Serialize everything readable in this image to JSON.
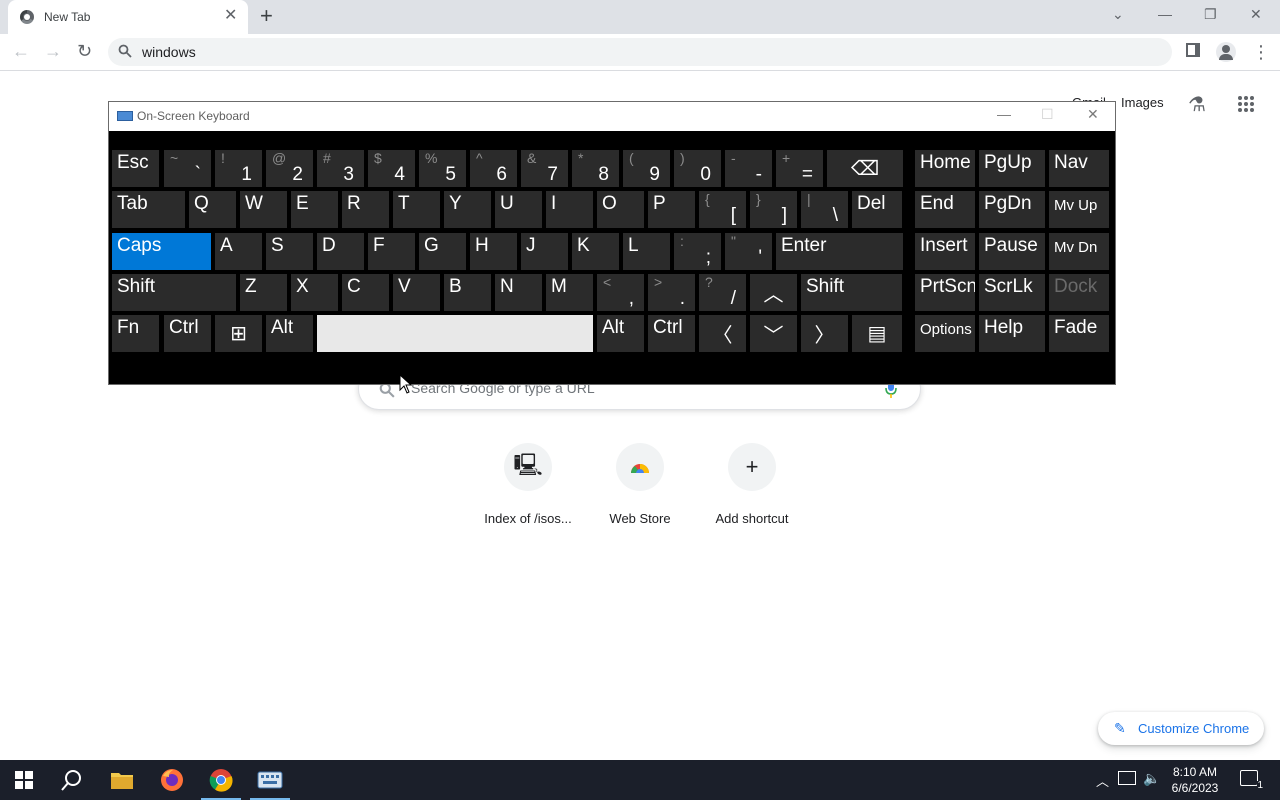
{
  "browser": {
    "tab_title": "New Tab",
    "tab_close": "✕",
    "new_tab": "+",
    "omnibox_text": "windows"
  },
  "ntp": {
    "gmail": "Gmail",
    "images": "Images",
    "search_placeholder": "Search Google or type a URL",
    "shortcuts": [
      {
        "label": "Index of /isos...",
        "icon": "computer-icon"
      },
      {
        "label": "Web Store",
        "icon": "webstore-icon"
      },
      {
        "label": "Add shortcut",
        "icon": "plus-icon"
      }
    ],
    "customize": "Customize Chrome"
  },
  "osk": {
    "title": "On-Screen Keyboard",
    "rows": [
      [
        {
          "main": "Esc"
        },
        {
          "sec": "~",
          "pri": "`"
        },
        {
          "sec": "!",
          "pri": "1"
        },
        {
          "sec": "@",
          "pri": "2"
        },
        {
          "sec": "#",
          "pri": "3"
        },
        {
          "sec": "$",
          "pri": "4"
        },
        {
          "sec": "%",
          "pri": "5"
        },
        {
          "sec": "^",
          "pri": "6"
        },
        {
          "sec": "&",
          "pri": "7"
        },
        {
          "sec": "*",
          "pri": "8"
        },
        {
          "sec": "(",
          "pri": "9"
        },
        {
          "sec": ")",
          "pri": "0"
        },
        {
          "sec": "-",
          "pri": "-"
        },
        {
          "sec": "+",
          "pri": "="
        },
        {
          "glyph": "⌫"
        },
        {
          "main": "Home"
        },
        {
          "main": "PgUp"
        },
        {
          "main": "Nav"
        }
      ],
      [
        {
          "main": "Tab"
        },
        {
          "main": "Q"
        },
        {
          "main": "W"
        },
        {
          "main": "E"
        },
        {
          "main": "R"
        },
        {
          "main": "T"
        },
        {
          "main": "Y"
        },
        {
          "main": "U"
        },
        {
          "main": "I"
        },
        {
          "main": "O"
        },
        {
          "main": "P"
        },
        {
          "sec": "{",
          "pri": "["
        },
        {
          "sec": "}",
          "pri": "]"
        },
        {
          "sec": "|",
          "pri": "\\"
        },
        {
          "main": "Del"
        },
        {
          "main": "End"
        },
        {
          "main": "PgDn"
        },
        {
          "main": "Mv Up",
          "small": true
        }
      ],
      [
        {
          "main": "Caps",
          "caps": true
        },
        {
          "main": "A"
        },
        {
          "main": "S"
        },
        {
          "main": "D"
        },
        {
          "main": "F"
        },
        {
          "main": "G"
        },
        {
          "main": "H"
        },
        {
          "main": "J"
        },
        {
          "main": "K"
        },
        {
          "main": "L"
        },
        {
          "sec": ":",
          "pri": ";"
        },
        {
          "sec": "\"",
          "pri": "'"
        },
        {
          "main": "Enter"
        },
        {
          "main": "Insert"
        },
        {
          "main": "Pause"
        },
        {
          "main": "Mv Dn",
          "small": true
        }
      ],
      [
        {
          "main": "Shift"
        },
        {
          "main": "Z"
        },
        {
          "main": "X"
        },
        {
          "main": "C"
        },
        {
          "main": "V"
        },
        {
          "main": "B"
        },
        {
          "main": "N"
        },
        {
          "main": "M"
        },
        {
          "sec": "<",
          "pri": ","
        },
        {
          "sec": ">",
          "pri": "."
        },
        {
          "sec": "?",
          "pri": "/"
        },
        {
          "glyph": "︿"
        },
        {
          "main": "Shift"
        },
        {
          "main": "PrtScn"
        },
        {
          "main": "ScrLk"
        },
        {
          "main": "Dock",
          "dimmed": true
        }
      ],
      [
        {
          "main": "Fn"
        },
        {
          "main": "Ctrl"
        },
        {
          "glyph": "⊞"
        },
        {
          "main": "Alt"
        },
        {
          "space": true
        },
        {
          "main": "Alt"
        },
        {
          "main": "Ctrl"
        },
        {
          "glyph": "〈"
        },
        {
          "glyph": "﹀"
        },
        {
          "glyph": "〉"
        },
        {
          "glyph": "▤"
        },
        {
          "main": "Options",
          "small": true
        },
        {
          "main": "Help"
        },
        {
          "main": "Fade"
        }
      ]
    ]
  },
  "taskbar": {
    "time": "8:10 AM",
    "date": "6/6/2023",
    "notification_count": "1"
  }
}
